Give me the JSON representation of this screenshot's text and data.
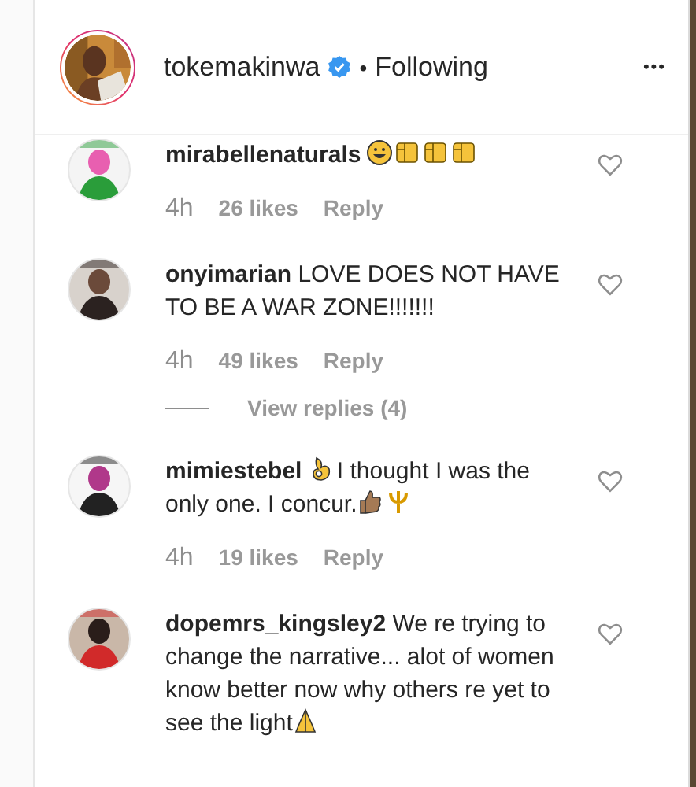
{
  "header": {
    "username": "tokemakinwa",
    "verified": true,
    "separator": "•",
    "follow_label": "Following",
    "more": "•••"
  },
  "comments": [
    {
      "username": "mirabellenaturals",
      "parts": [
        {
          "kind": "emoji-grin"
        },
        {
          "kind": "emoji-clap"
        },
        {
          "kind": "emoji-clap"
        },
        {
          "kind": "emoji-clap"
        }
      ],
      "time": "4h",
      "likes": "26 likes",
      "reply": "Reply",
      "liked": false
    },
    {
      "username": "onyimarian",
      "parts": [
        {
          "kind": "text",
          "text": "LOVE DOES NOT HAVE TO BE A WAR ZONE!!!!!!!"
        }
      ],
      "time": "4h",
      "likes": "49 likes",
      "reply": "Reply",
      "liked": false,
      "view_replies": "View replies (4)"
    },
    {
      "username": "mimiestebel",
      "parts": [
        {
          "kind": "emoji-ok"
        },
        {
          "kind": "text",
          "text": "I thought I was the only one. I concur."
        },
        {
          "kind": "emoji-thumb"
        },
        {
          "kind": "emoji-trident"
        }
      ],
      "time": "4h",
      "likes": "19 likes",
      "reply": "Reply",
      "liked": false
    },
    {
      "username": "dopemrs_kingsley2",
      "parts": [
        {
          "kind": "text",
          "text": "We re trying to change the narrative... alot of women know better now why others re yet to see the light"
        },
        {
          "kind": "emoji-pray"
        }
      ],
      "liked": false
    }
  ]
}
